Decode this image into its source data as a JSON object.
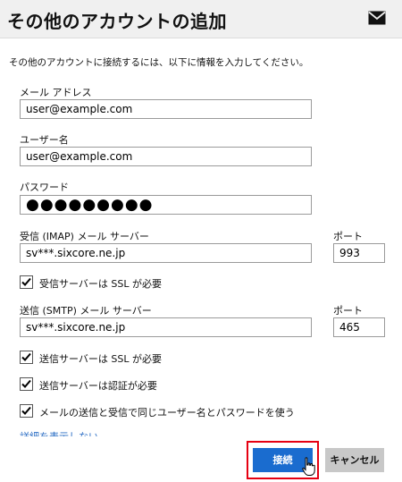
{
  "header": {
    "title": "その他のアカウントの追加",
    "icon": "mail-icon"
  },
  "intro": "その他のアカウントに接続するには、以下に情報を入力してください。",
  "fields": {
    "email": {
      "label": "メール アドレス",
      "value": "user@example.com"
    },
    "username": {
      "label": "ユーザー名",
      "value": "user@example.com"
    },
    "password": {
      "label": "パスワード",
      "value": "●●●●●●●●●"
    },
    "incoming_server": {
      "label": "受信 (IMAP) メール サーバー",
      "value": "sv***.sixcore.ne.jp"
    },
    "incoming_port": {
      "label": "ポート",
      "value": "993"
    },
    "outgoing_server": {
      "label": "送信 (SMTP) メール サーバー",
      "value": "sv***.sixcore.ne.jp"
    },
    "outgoing_port": {
      "label": "ポート",
      "value": "465"
    }
  },
  "checks": {
    "incoming_ssl": {
      "label": "受信サーバーは SSL が必要",
      "checked": true
    },
    "outgoing_ssl": {
      "label": "送信サーバーは SSL が必要",
      "checked": true
    },
    "outgoing_auth": {
      "label": "送信サーバーは認証が必要",
      "checked": true
    },
    "same_credentials": {
      "label": "メールの送信と受信で同じユーザー名とパスワードを使う",
      "checked": true
    }
  },
  "details_link": "詳細を表示しない",
  "buttons": {
    "connect": "接続",
    "cancel": "キャンセル"
  },
  "colors": {
    "header_bg": "#f0f0f0",
    "primary_button": "#1a6ccf",
    "secondary_button": "#c8c8c8",
    "highlight": "#e60012",
    "link": "#2d6fc5"
  }
}
